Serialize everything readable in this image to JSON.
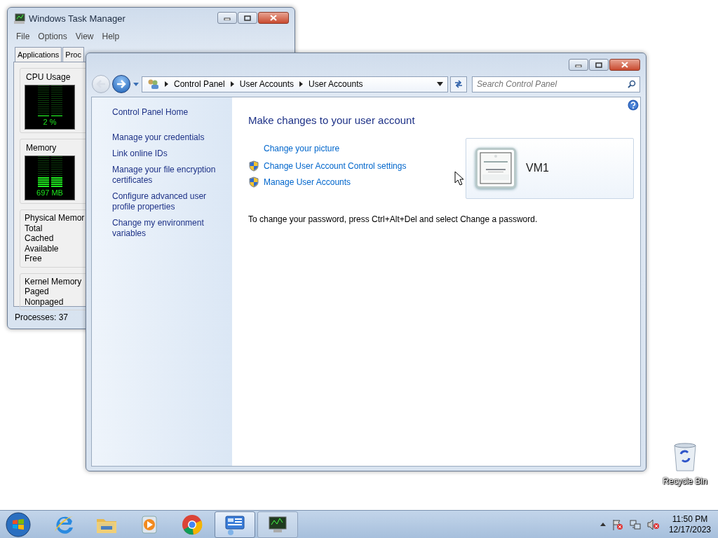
{
  "task_manager": {
    "title": "Windows Task Manager",
    "menu": [
      "File",
      "Options",
      "View",
      "Help"
    ],
    "tabs": [
      {
        "label": "Applications",
        "selected": false
      },
      {
        "label": "Proc",
        "selected": false
      }
    ],
    "meters": [
      {
        "label": "CPU Usage",
        "reading": "2 %",
        "level": 0.02
      },
      {
        "label": "Memory",
        "reading": "697 MB",
        "level": 0.3
      }
    ],
    "groups": [
      {
        "title": "Physical Memor",
        "rows": [
          "Total",
          "Cached",
          "Available",
          "Free"
        ]
      },
      {
        "title": "Kernel Memory",
        "rows": [
          "Paged",
          "Nonpaged"
        ]
      }
    ],
    "status_bar": "Processes: 37"
  },
  "control_panel": {
    "back": {
      "disabled": true
    },
    "forward": {
      "disabled": false
    },
    "breadcrumb": [
      "Control Panel",
      "User Accounts",
      "User Accounts"
    ],
    "search": {
      "placeholder": "Search Control Panel"
    },
    "sidebar": {
      "home": "Control Panel Home",
      "items": [
        "Manage your credentials",
        "Link online IDs",
        "Manage your file encryption certificates",
        "Configure advanced user profile properties",
        "Change my environment variables"
      ]
    },
    "heading": "Make changes to your user account",
    "links": [
      {
        "label": "Change your picture",
        "kind": "plain"
      },
      {
        "label": "Change User Account Control settings",
        "kind": "shield"
      },
      {
        "label": "Manage User Accounts",
        "kind": "shield"
      }
    ],
    "account": {
      "name": "VM1"
    },
    "note": "To change your password, press Ctrl+Alt+Del and select Change a password."
  },
  "desktop_icons": [
    {
      "label": "Recycle Bin",
      "kind": "recycle"
    }
  ],
  "taskbar": {
    "apps": [
      {
        "kind": "ie",
        "active": false
      },
      {
        "kind": "explorer",
        "active": false
      },
      {
        "kind": "media",
        "active": false
      },
      {
        "kind": "chrome",
        "active": false
      },
      {
        "kind": "controlpanel",
        "active": true
      },
      {
        "kind": "taskmgr",
        "active": false
      }
    ],
    "time": "11:50 PM",
    "date": "12/17/2023"
  }
}
